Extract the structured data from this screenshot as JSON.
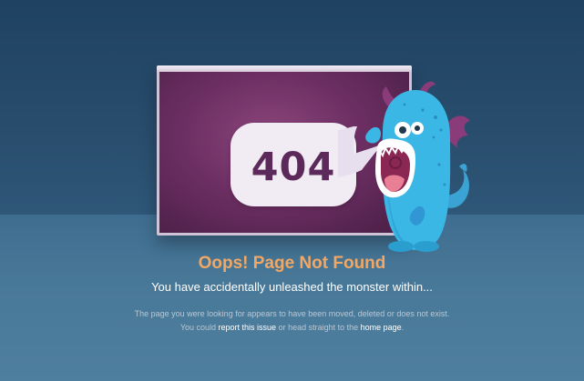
{
  "error": {
    "code": "404",
    "title": "Oops! Page Not Found",
    "subtitle": "You have accidentally unleashed the monster within...",
    "description_line1": "The page you were looking for appears to have been moved, deleted or does not exist.",
    "description_line2_prefix": "You could ",
    "report_link": "report this issue",
    "description_line2_middle": " or head straight to the ",
    "home_link": "home page",
    "description_line2_suffix": "."
  },
  "colors": {
    "background": "#2a4e6f",
    "title": "#f2a864",
    "text": "#ffffff",
    "muted": "#b8c7d5",
    "screen": "#6d2f63",
    "monster": "#3bb7e6"
  },
  "icons": {
    "speech_bubble": "speech-bubble-icon",
    "monster": "monster-illustration"
  }
}
